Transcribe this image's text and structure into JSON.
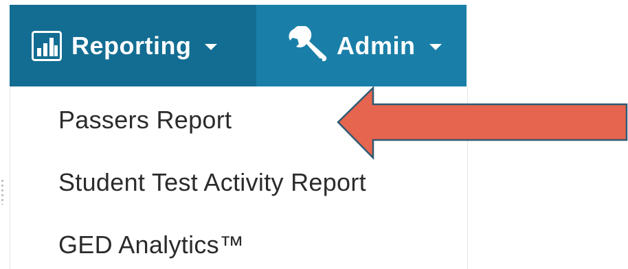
{
  "nav": {
    "reporting": {
      "label": "Reporting",
      "icon": "bar-chart-icon",
      "caret_icon": "caret-down-icon"
    },
    "admin": {
      "label": "Admin",
      "icon": "wrench-icon",
      "caret_icon": "caret-down-icon"
    }
  },
  "dropdown": {
    "items": [
      {
        "label": "Passers Report"
      },
      {
        "label": "Student Test Activity Report"
      },
      {
        "label": "GED Analytics™"
      }
    ]
  },
  "annotation": {
    "arrow_icon": "left-arrow-icon",
    "arrow_color": "#e6654f",
    "arrow_outline": "#2e5a73"
  },
  "colors": {
    "nav_bg": "#1a7fa8",
    "nav_active_bg": "#136d92",
    "menu_text": "#2b2b2b"
  }
}
